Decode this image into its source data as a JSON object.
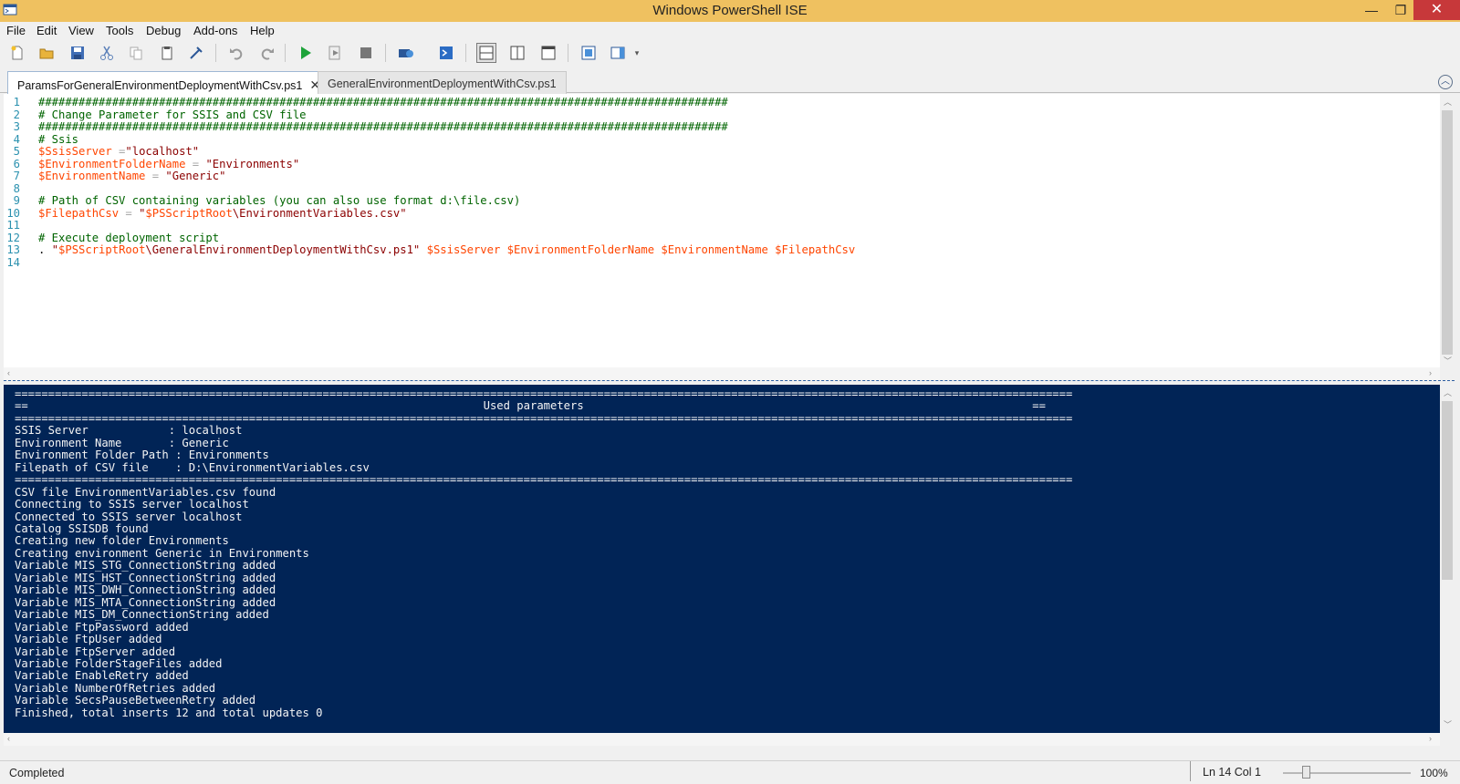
{
  "window": {
    "title": "Windows PowerShell ISE",
    "minimize_glyph": "—",
    "maximize_glyph": "❐",
    "close_glyph": "✕"
  },
  "menu": [
    "File",
    "Edit",
    "View",
    "Tools",
    "Debug",
    "Add-ons",
    "Help"
  ],
  "toolbar_icons": [
    "new-icon",
    "open-icon",
    "save-icon",
    "cut-icon",
    "copy-icon",
    "paste-icon",
    "clear-icon",
    "undo-icon",
    "redo-icon",
    "run-icon",
    "run-selection-icon",
    "stop-icon",
    "remote-powershell-icon",
    "console-icon",
    "layout-top-icon",
    "layout-right-icon",
    "layout-max-icon",
    "command-addon-icon",
    "show-commands-icon"
  ],
  "tabs": [
    {
      "label": "ParamsForGeneralEnvironmentDeploymentWithCsv.ps1",
      "active": true,
      "close": "✕"
    },
    {
      "label": "GeneralEnvironmentDeploymentWithCsv.ps1",
      "active": false
    }
  ],
  "editor": {
    "lines": [
      {
        "n": "1",
        "hash": "#######################################################################################################"
      },
      {
        "n": "2",
        "comment": "# Change Parameter for SSIS and CSV file"
      },
      {
        "n": "3",
        "hash": "#######################################################################################################"
      },
      {
        "n": "4",
        "comment": "# Ssis"
      },
      {
        "n": "5",
        "var": "$SsisServer",
        "op": " =",
        "str": "\"localhost\""
      },
      {
        "n": "6",
        "var": "$EnvironmentFolderName",
        "op": " = ",
        "str": "\"Environments\""
      },
      {
        "n": "7",
        "var": "$EnvironmentName",
        "op": " = ",
        "str": "\"Generic\""
      },
      {
        "n": "8"
      },
      {
        "n": "9",
        "comment": "# Path of CSV containing variables (you can also use format d:\\file.csv)"
      },
      {
        "n": "10",
        "var": "$FilepathCsv",
        "op": " = ",
        "str_open": "\"",
        "str_var": "$PSScriptRoot",
        "str_rest": "\\EnvironmentVariables.csv\""
      },
      {
        "n": "11"
      },
      {
        "n": "12",
        "comment": "# Execute deployment script"
      },
      {
        "n": "13",
        "dot": ". ",
        "str_open": "\"",
        "str_var": "$PSScriptRoot",
        "str_rest": "\\GeneralEnvironmentDeploymentWithCsv.ps1\"",
        "args": " $SsisServer $EnvironmentFolderName $EnvironmentName $FilepathCsv"
      },
      {
        "n": "14"
      }
    ]
  },
  "console": {
    "text": "==============================================================================================================================================================\n==                                                                    Used parameters                                                                   ==\n==============================================================================================================================================================\nSSIS Server            : localhost\nEnvironment Name       : Generic\nEnvironment Folder Path : Environments\nFilepath of CSV file    : D:\\EnvironmentVariables.csv\n==============================================================================================================================================================\nCSV file EnvironmentVariables.csv found\nConnecting to SSIS server localhost\nConnected to SSIS server localhost\nCatalog SSISDB found\nCreating new folder Environments\nCreating environment Generic in Environments\nVariable MIS_STG_ConnectionString added\nVariable MIS_HST_ConnectionString added\nVariable MIS_DWH_ConnectionString added\nVariable MIS_MTA_ConnectionString added\nVariable MIS_DM_ConnectionString added\nVariable FtpPassword added\nVariable FtpUser added\nVariable FtpServer added\nVariable FolderStageFiles added\nVariable EnableRetry added\nVariable NumberOfRetries added\nVariable SecsPauseBetweenRetry added\nFinished, total inserts 12 and total updates 0"
  },
  "status": {
    "message": "Completed",
    "position": "Ln 14  Col 1",
    "zoom": "100%",
    "zoom_fraction": 0.18
  },
  "colors": {
    "titlebar": "#efc160",
    "console_bg": "#012456",
    "close_btn": "#c7383a"
  }
}
